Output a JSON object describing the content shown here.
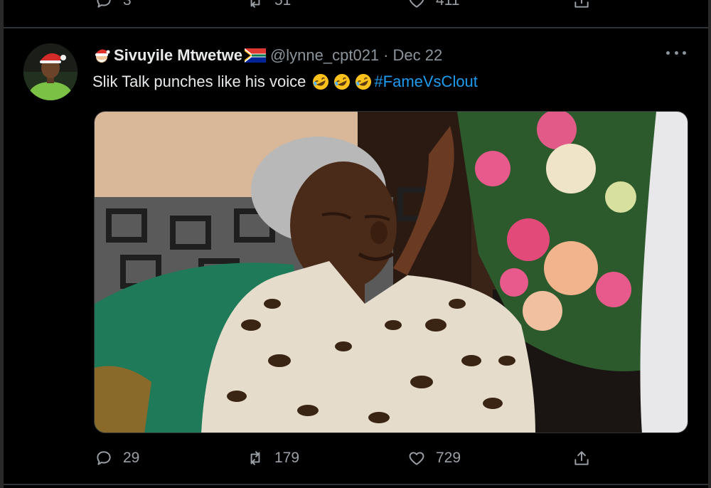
{
  "prev_tweet": {
    "reply_count": "3",
    "retweet_count": "51",
    "like_count": "411"
  },
  "tweet": {
    "display_name": "Sivuyile Mtwetwe",
    "handle": "@lynne_cpt021",
    "separator": "·",
    "date": "Dec 22",
    "text": "Slik Talk punches like his voice",
    "hashtag": "#FameVsClout",
    "name_emojis": [
      "santa-emoji",
      "south-africa-flag-emoji"
    ],
    "text_emojis": [
      "rolling-laughing-emoji",
      "rolling-laughing-emoji",
      "rolling-laughing-emoji"
    ],
    "reply_count": "29",
    "retweet_count": "179",
    "like_count": "729"
  },
  "colors": {
    "background": "#000000",
    "text": "#e7e9ea",
    "secondary_text": "#8b949b",
    "link": "#1d9bf0",
    "divider": "#2f3336"
  }
}
